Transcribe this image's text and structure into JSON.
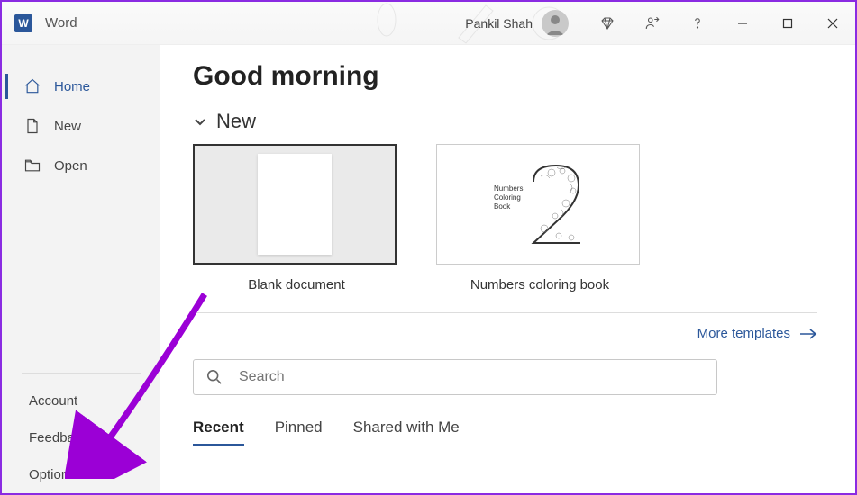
{
  "titlebar": {
    "app_name": "Word",
    "user_name": "Pankil Shah"
  },
  "sidebar": {
    "nav": [
      {
        "label": "Home",
        "icon": "home-icon",
        "active": true
      },
      {
        "label": "New",
        "icon": "document-icon",
        "active": false
      },
      {
        "label": "Open",
        "icon": "folder-icon",
        "active": false
      }
    ],
    "bottom": [
      {
        "label": "Account"
      },
      {
        "label": "Feedback"
      },
      {
        "label": "Options"
      }
    ]
  },
  "content": {
    "greeting": "Good morning",
    "new_section": {
      "title": "New",
      "templates": [
        {
          "label": "Blank document",
          "kind": "blank",
          "selected": true
        },
        {
          "label": "Numbers coloring book",
          "kind": "coloring",
          "selected": false,
          "preview_text": {
            "line1": "Numbers",
            "line2": "Coloring",
            "line3": "Book"
          }
        }
      ],
      "more_link": "More templates"
    },
    "search": {
      "placeholder": "Search"
    },
    "tabs": [
      {
        "label": "Recent",
        "active": true
      },
      {
        "label": "Pinned",
        "active": false
      },
      {
        "label": "Shared with Me",
        "active": false
      }
    ]
  },
  "colors": {
    "accent": "#2B579A",
    "annotation": "#9b00d6"
  }
}
